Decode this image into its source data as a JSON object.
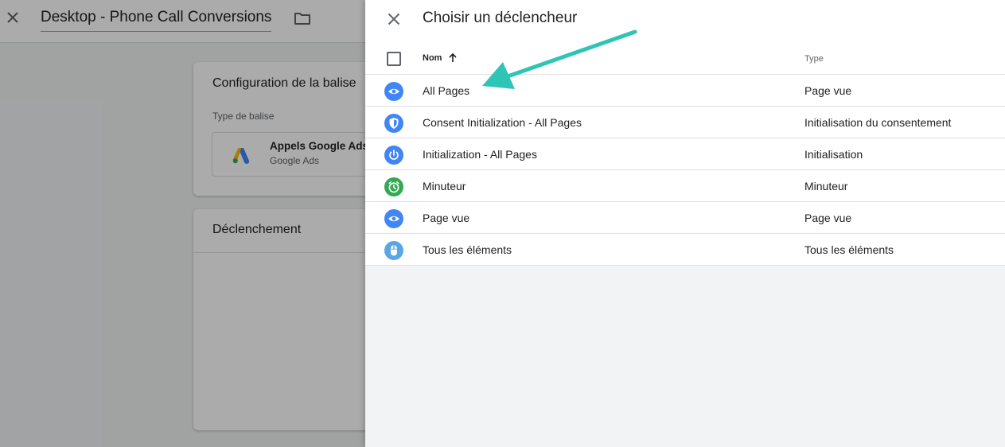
{
  "editor": {
    "title": "Desktop - Phone Call Conversions",
    "config_card": {
      "title": "Configuration de la balise",
      "type_label": "Type de balise",
      "tag_name": "Appels Google Ads",
      "tag_sub": "Google Ads"
    },
    "trigger_card": {
      "title": "Déclenchement"
    }
  },
  "panel": {
    "title": "Choisir un déclencheur",
    "columns": {
      "name": "Nom",
      "type": "Type"
    },
    "rows": [
      {
        "name": "All Pages",
        "type": "Page vue",
        "icon": "eye-icon",
        "icon_color": "#4285f4"
      },
      {
        "name": "Consent Initialization - All Pages",
        "type": "Initialisation du consentement",
        "icon": "shield-icon",
        "icon_color": "#4285f4"
      },
      {
        "name": "Initialization - All Pages",
        "type": "Initialisation",
        "icon": "power-icon",
        "icon_color": "#4285f4"
      },
      {
        "name": "Minuteur",
        "type": "Minuteur",
        "icon": "alarm-icon",
        "icon_color": "#34a853"
      },
      {
        "name": "Page vue",
        "type": "Page vue",
        "icon": "eye-icon",
        "icon_color": "#4285f4"
      },
      {
        "name": "Tous les éléments",
        "type": "Tous les éléments",
        "icon": "mouse-icon",
        "icon_color": "#5aa7e6"
      }
    ]
  },
  "annotation": {
    "arrow_color": "#2ec4b6"
  }
}
